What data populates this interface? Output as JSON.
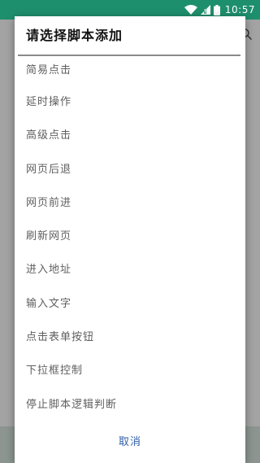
{
  "status_bar": {
    "time": "10:57",
    "icons": [
      "wifi-icon",
      "signal-icon",
      "battery-icon"
    ]
  },
  "background_app": {
    "icons": [
      "search-icon"
    ]
  },
  "dialog": {
    "title": "请选择脚本添加",
    "options": [
      "简易点击",
      "延时操作",
      "高级点击",
      "网页后退",
      "网页前进",
      "刷新网页",
      "进入地址",
      "输入文字",
      "点击表单按钮",
      "下拉框控制",
      "停止脚本逻辑判断"
    ],
    "cancel_label": "取消"
  },
  "colors": {
    "status_bar": "#1e8f6d",
    "cancel_text": "#2f5fa8",
    "option_text": "#5f5f5f"
  }
}
